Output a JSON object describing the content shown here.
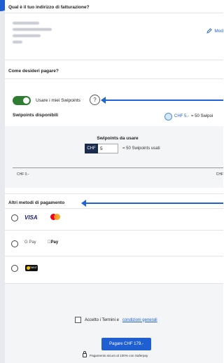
{
  "billing": {
    "question": "Qual è il tuo indirizzo di fatturazione?",
    "modify_label": "Mod"
  },
  "payment": {
    "question": "Come desideri pagare?"
  },
  "swipoints": {
    "toggle_label": "Usare i miei Swipoints",
    "toggle_on": true,
    "help_symbol": "?",
    "available_label": "Swipoints disponibili",
    "available_value": "CHF 5.-",
    "available_note": "= 50 Swipoi",
    "use_title": "Swipoints da usare",
    "currency_badge": "CHF",
    "amount_value": "5",
    "used_text": "= 50 Swipoints usati",
    "slider_min": "CHF 0.-",
    "slider_max": "CHF",
    "slider_fraction": 1.0
  },
  "other_methods": {
    "title": "Altri metodi di pagamento",
    "rows": [
      {
        "brands": [
          "VISA",
          "mastercard-icon"
        ]
      },
      {
        "brands": [
          "G Pay",
          "Pay"
        ]
      },
      {
        "brands": [
          "twint-icon"
        ]
      }
    ],
    "visa_label": "VISA",
    "gpay_label": "G Pay",
    "apay_label": "Pay",
    "twint_label": "TWINT"
  },
  "terms": {
    "prefix": "Accetto i Termini e",
    "link": "condizioni generali",
    "checked": false
  },
  "pay_button_label": "Pagare CHF 179.-",
  "secure_text": "Pagamento sicuro al 100% con Saferpay",
  "colors": {
    "accent": "#1f5fd1",
    "toggle_on": "#2e7d32",
    "arrow": "#1f63d6"
  }
}
